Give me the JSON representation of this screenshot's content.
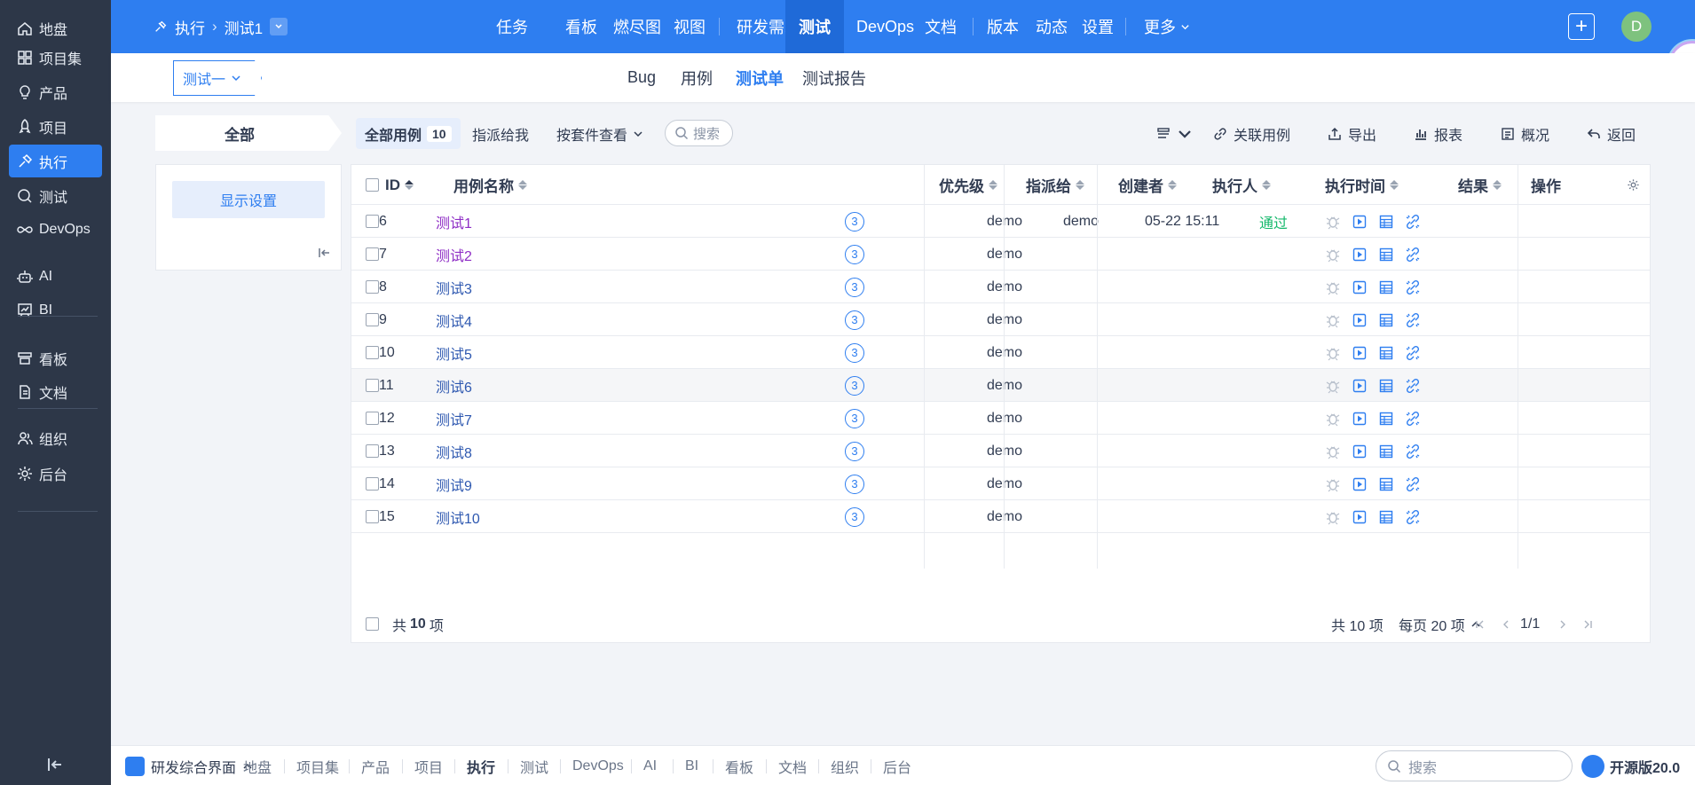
{
  "colors": {
    "primary": "#2e7ef0",
    "sidebar_bg": "#2d3748",
    "pass": "#14b86b",
    "visited_link": "#8e2dc5"
  },
  "sidebar": {
    "items": [
      {
        "label": "地盘",
        "icon": "home-icon"
      },
      {
        "label": "项目集",
        "icon": "grid-icon"
      },
      {
        "label": "产品",
        "icon": "bulb-icon"
      },
      {
        "label": "项目",
        "icon": "rocket-icon"
      },
      {
        "label": "执行",
        "icon": "execute-icon",
        "active": true
      },
      {
        "label": "测试",
        "icon": "search-test-icon"
      },
      {
        "label": "DevOps",
        "icon": "infinity-icon"
      },
      {
        "label": "AI",
        "icon": "robot-icon"
      },
      {
        "label": "BI",
        "icon": "chart-board-icon"
      },
      {
        "label": "看板",
        "icon": "kanban-icon"
      },
      {
        "label": "文档",
        "icon": "doc-icon"
      },
      {
        "label": "组织",
        "icon": "people-icon"
      },
      {
        "label": "后台",
        "icon": "gear-icon"
      }
    ]
  },
  "header": {
    "breadcrumb": {
      "module": "执行",
      "object": "测试1"
    },
    "nav": [
      "任务",
      "看板",
      "燃尽图",
      "视图",
      "研发需求",
      "测试",
      "DevOps",
      "文档",
      "版本",
      "动态",
      "设置",
      "更多"
    ],
    "active_nav": "测试",
    "avatar_letter": "D"
  },
  "subheader": {
    "execution_select": "测试一",
    "tabs": [
      "Bug",
      "用例",
      "测试单",
      "测试报告"
    ],
    "active_tab": "测试单"
  },
  "toolbar": {
    "all_label": "全部",
    "filter_all": "全部用例",
    "filter_all_count": "10",
    "assigned_to_me": "指派给我",
    "by_suite": "按套件查看",
    "search": "搜索",
    "link_cases": "关联用例",
    "export": "导出",
    "report": "报表",
    "overview": "概况",
    "back": "返回"
  },
  "left_panel": {
    "display_settings": "显示设置"
  },
  "table": {
    "columns": {
      "id": "ID",
      "name": "用例名称",
      "priority": "优先级",
      "assigned": "指派给",
      "creator": "创建者",
      "executor": "执行人",
      "exec_time": "执行时间",
      "result": "结果",
      "actions": "操作"
    },
    "rows": [
      {
        "id": "6",
        "name": "测试1",
        "pri": "3",
        "assigned": "",
        "creator": "demo",
        "executor": "demo",
        "time": "05-22 15:11",
        "result": "通过",
        "visited": true
      },
      {
        "id": "7",
        "name": "测试2",
        "pri": "3",
        "assigned": "",
        "creator": "demo",
        "executor": "",
        "time": "",
        "result": "",
        "visited": true
      },
      {
        "id": "8",
        "name": "测试3",
        "pri": "3",
        "assigned": "",
        "creator": "demo",
        "executor": "",
        "time": "",
        "result": ""
      },
      {
        "id": "9",
        "name": "测试4",
        "pri": "3",
        "assigned": "",
        "creator": "demo",
        "executor": "",
        "time": "",
        "result": ""
      },
      {
        "id": "10",
        "name": "测试5",
        "pri": "3",
        "assigned": "",
        "creator": "demo",
        "executor": "",
        "time": "",
        "result": ""
      },
      {
        "id": "11",
        "name": "测试6",
        "pri": "3",
        "assigned": "",
        "creator": "demo",
        "executor": "",
        "time": "",
        "result": "",
        "hover": true
      },
      {
        "id": "12",
        "name": "测试7",
        "pri": "3",
        "assigned": "",
        "creator": "demo",
        "executor": "",
        "time": "",
        "result": ""
      },
      {
        "id": "13",
        "name": "测试8",
        "pri": "3",
        "assigned": "",
        "creator": "demo",
        "executor": "",
        "time": "",
        "result": ""
      },
      {
        "id": "14",
        "name": "测试9",
        "pri": "3",
        "assigned": "",
        "creator": "demo",
        "executor": "",
        "time": "",
        "result": ""
      },
      {
        "id": "15",
        "name": "测试10",
        "pri": "3",
        "assigned": "",
        "creator": "demo",
        "executor": "",
        "time": "",
        "result": ""
      }
    ],
    "footer": {
      "total_prefix": "共",
      "total_count": "10",
      "total_suffix": "项",
      "summary": "共 10 项",
      "per_page": "每页 20 项",
      "page": "1/1"
    }
  },
  "bottombar": {
    "app_label": "研发综合界面",
    "items": [
      "地盘",
      "项目集",
      "产品",
      "项目",
      "执行",
      "测试",
      "DevOps",
      "AI",
      "BI",
      "看板",
      "文档",
      "组织",
      "后台"
    ],
    "active_item": "执行",
    "search": "搜索",
    "version": "开源版20.0"
  }
}
